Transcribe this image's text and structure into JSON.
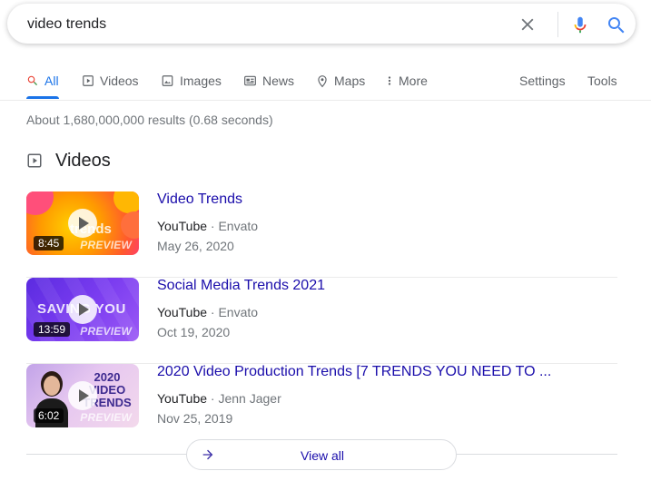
{
  "search": {
    "query": "video trends"
  },
  "tabs": [
    {
      "label": "All",
      "active": true
    },
    {
      "label": "Videos"
    },
    {
      "label": "Images"
    },
    {
      "label": "News"
    },
    {
      "label": "Maps"
    },
    {
      "label": "More"
    }
  ],
  "tools": {
    "settings": "Settings",
    "tools": "Tools"
  },
  "result_stats": "About 1,680,000,000 results (0.68 seconds)",
  "videos_section": {
    "title": "Videos",
    "items": [
      {
        "title": "Video Trends",
        "source": "YouTube",
        "channel": "Envato",
        "date": "May 26, 2020",
        "duration": "8:45",
        "preview": "PREVIEW",
        "thumb_text": "trends"
      },
      {
        "title": "Social Media Trends 2021",
        "source": "YouTube",
        "channel": "Envato",
        "date": "Oct 19, 2020",
        "duration": "13:59",
        "preview": "PREVIEW",
        "thumb_text": "SAVING YOU"
      },
      {
        "title": "2020 Video Production Trends [7 TRENDS YOU NEED TO ...",
        "source": "YouTube",
        "channel": "Jenn Jager",
        "date": "Nov 25, 2019",
        "duration": "6:02",
        "preview": "PREVIEW",
        "thumb_text": "2020 VIDEO TRENDS"
      }
    ],
    "separator": " · "
  },
  "view_all": "View all",
  "colors": {
    "accent": "#1a73e8",
    "link": "#1a0dab",
    "muted": "#70757a"
  }
}
